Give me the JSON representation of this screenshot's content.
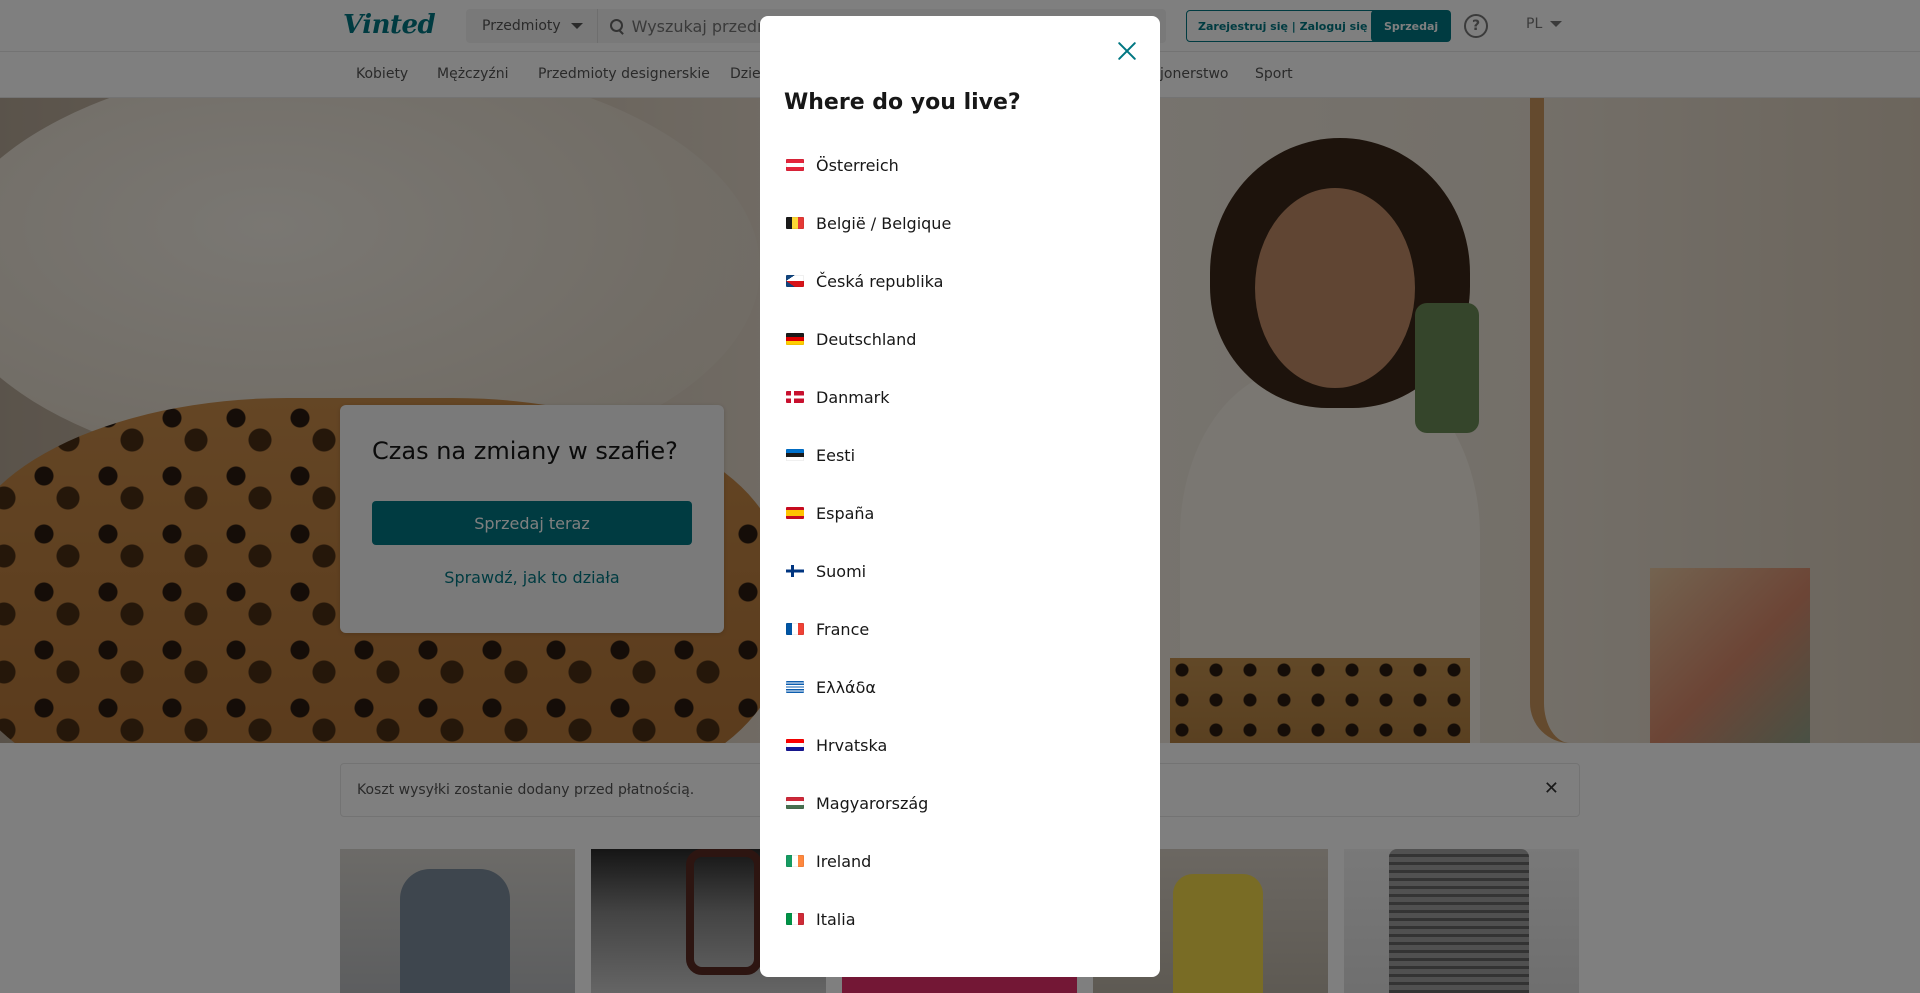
{
  "header": {
    "logo": "Vinted",
    "category_select": "Przedmioty",
    "search_placeholder": "Wyszukaj przedmioty",
    "auth_button": "Zarejestruj się | Zaloguj się",
    "sell_button": "Sprzedaj",
    "help_icon": "?",
    "language": "PL"
  },
  "nav": {
    "items": [
      {
        "label": "Kobiety"
      },
      {
        "label": "Mężczyźni"
      },
      {
        "label": "Przedmioty designerskie"
      },
      {
        "label": "Dzie"
      },
      {
        "label": "jonerstwo"
      },
      {
        "label": "Sport"
      }
    ]
  },
  "hero": {
    "title": "Czas na zmiany w szafie?",
    "sell_now_button": "Sprzedaj teraz",
    "how_it_works_link": "Sprawdź, jak to działa"
  },
  "info_banner": {
    "text": "Koszt wysyłki zostanie dodany przed płatnością.",
    "close": "✕"
  },
  "modal": {
    "title": "Where do you live?",
    "countries": [
      {
        "label": "Österreich",
        "flag_colors": [
          "#e4253b",
          "#ffffff",
          "#e4253b"
        ],
        "flag_dir": "h"
      },
      {
        "label": "België / Belgique",
        "flag_colors": [
          "#1a1a1a",
          "#fdd835",
          "#e53935"
        ],
        "flag_dir": "v"
      },
      {
        "label": "Česká republika",
        "flag_colors": [
          "#ffffff",
          "#d7141a"
        ],
        "flag_dir": "cz"
      },
      {
        "label": "Deutschland",
        "flag_colors": [
          "#1a1a1a",
          "#dd0000",
          "#ffce00"
        ],
        "flag_dir": "h"
      },
      {
        "label": "Danmark",
        "flag_colors": [
          "#c8102e",
          "#ffffff"
        ],
        "flag_dir": "nordic"
      },
      {
        "label": "Eesti",
        "flag_colors": [
          "#0072ce",
          "#1a1a1a",
          "#ffffff"
        ],
        "flag_dir": "h"
      },
      {
        "label": "España",
        "flag_colors": [
          "#c60b1e",
          "#ffc400",
          "#c60b1e"
        ],
        "flag_dir": "es"
      },
      {
        "label": "Suomi",
        "flag_colors": [
          "#ffffff",
          "#003580"
        ],
        "flag_dir": "nordic"
      },
      {
        "label": "France",
        "flag_colors": [
          "#0055a4",
          "#ffffff",
          "#ef4135"
        ],
        "flag_dir": "v"
      },
      {
        "label": "Ελλάδα",
        "flag_colors": [
          "#0d5eaf",
          "#ffffff"
        ],
        "flag_dir": "gr"
      },
      {
        "label": "Hrvatska",
        "flag_colors": [
          "#ff0000",
          "#ffffff",
          "#171796"
        ],
        "flag_dir": "h"
      },
      {
        "label": "Magyarország",
        "flag_colors": [
          "#ce2939",
          "#ffffff",
          "#477050"
        ],
        "flag_dir": "h"
      },
      {
        "label": "Ireland",
        "flag_colors": [
          "#169b62",
          "#ffffff",
          "#ff883e"
        ],
        "flag_dir": "v"
      },
      {
        "label": "Italia",
        "flag_colors": [
          "#009246",
          "#ffffff",
          "#ce2b37"
        ],
        "flag_dir": "v"
      }
    ]
  },
  "colors": {
    "brand": "#007782",
    "overlay": "rgba(0,0,0,0.5)"
  }
}
